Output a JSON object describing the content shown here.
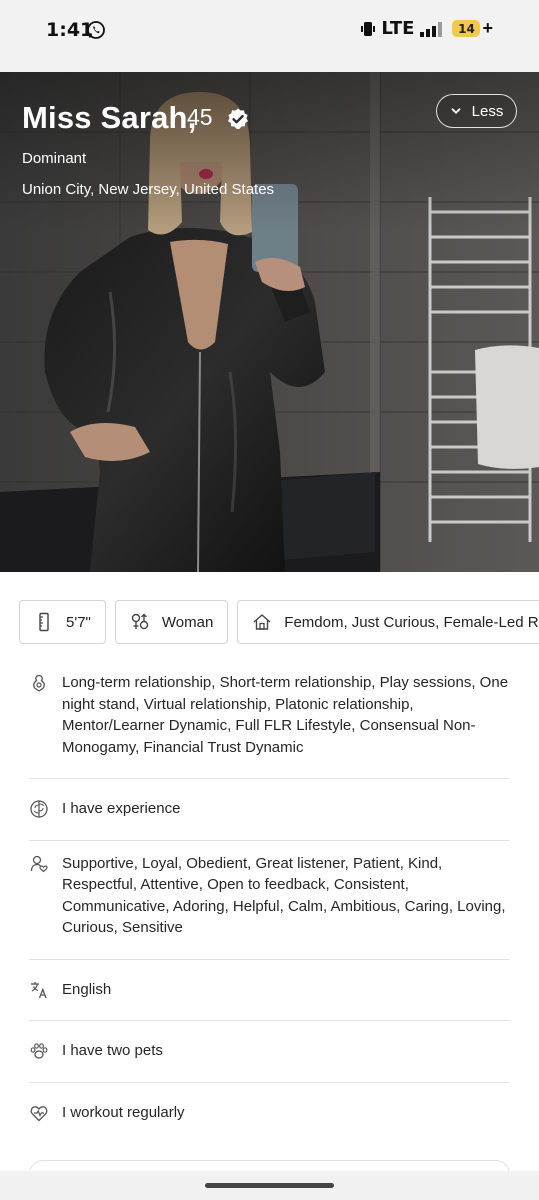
{
  "status_bar": {
    "time": "1:41",
    "network": "LTE",
    "battery": "14",
    "battery_plus": "+"
  },
  "profile": {
    "name": "Miss Sarah,",
    "age": "45",
    "role": "Dominant",
    "location": "Union City, New Jersey, United States",
    "collapse_label": "Less"
  },
  "chips": {
    "height": "5'7\"",
    "gender": "Woman",
    "interests": "Femdom, Just Curious, Female-Led Relationship"
  },
  "details": {
    "relationship": "Long-term relationship, Short-term relationship, Play sessions, One night stand, Virtual relationship, Platonic relationship, Mentor/Learner Dynamic, Full FLR Lifestyle, Consensual Non-Monogamy, Financial Trust Dynamic",
    "experience": "I have experience",
    "traits": "Supportive, Loyal, Obedient, Great listener, Patient, Kind, Respectful, Attentive, Open to feedback, Consistent, Communicative, Adoring, Helpful, Calm, Ambitious, Caring, Loving, Curious, Sensitive",
    "language": "English",
    "pets": "I have two pets",
    "fitness": "I workout regularly"
  },
  "icons": {
    "whatsapp": "whatsapp-icon",
    "verified": "verified-badge-icon",
    "chevron": "chevron-down-icon",
    "height": "ruler-icon",
    "gender": "gender-icon",
    "interests": "house-icon",
    "relationship": "relationship-icon",
    "experience": "brain-icon",
    "traits": "personality-icon",
    "language": "translate-icon",
    "pets": "paw-icon",
    "fitness": "heart-pulse-icon"
  }
}
